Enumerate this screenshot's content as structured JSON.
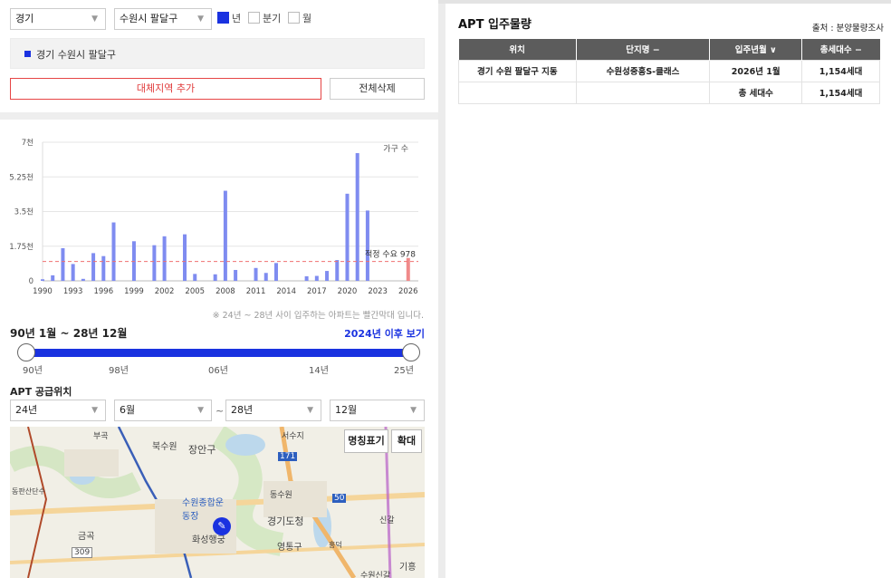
{
  "filters": {
    "province": "경기",
    "city": "수원시 팔달구",
    "period_options": [
      {
        "label": "년",
        "checked": true
      },
      {
        "label": "분기",
        "checked": false
      },
      {
        "label": "월",
        "checked": false
      }
    ]
  },
  "selected_region": "경기 수원시 팔달구",
  "buttons": {
    "add_region": "대체지역 추가",
    "delete_all": "전체삭제"
  },
  "chart_data": {
    "type": "bar",
    "legend": "가구 수",
    "y_ticks": [
      "7천",
      "5.25천",
      "3.5천",
      "1.75천",
      "0"
    ],
    "ylim": [
      0,
      7000
    ],
    "xlim": [
      1990,
      2027
    ],
    "x_ticks": [
      "1990",
      "1993",
      "1996",
      "1999",
      "2002",
      "2005",
      "2008",
      "2011",
      "2014",
      "2017",
      "2020",
      "2023",
      "2026"
    ],
    "x": [
      1990,
      1991,
      1992,
      1993,
      1994,
      1995,
      1996,
      1997,
      1999,
      2001,
      2002,
      2004,
      2005,
      2007,
      2008,
      2009,
      2011,
      2012,
      2013,
      2016,
      2017,
      2018,
      2019,
      2020,
      2021,
      2022,
      2023,
      2026
    ],
    "values": [
      80,
      280,
      1650,
      850,
      100,
      1400,
      1250,
      2950,
      2000,
      1800,
      2250,
      2350,
      350,
      330,
      4550,
      550,
      650,
      400,
      900,
      230,
      250,
      500,
      1050,
      4400,
      6450,
      3550,
      0,
      1154
    ],
    "highlight_from": 2024,
    "bar_color": "#7f8cf0",
    "highlight_color": "#f08a8a",
    "reference_line": {
      "label": "적정 수요",
      "value": 978,
      "display": "978",
      "color": "#f07070"
    },
    "note": "※ 24년 ~ 28년 사이 입주하는 아파트는 빨간막대 입니다."
  },
  "range": {
    "label": "90년 1월 ~ 28년 12월",
    "after_link": "2024년 이후 보기",
    "tick_labels": [
      "90년",
      "98년",
      "06년",
      "14년",
      "25년"
    ]
  },
  "supply": {
    "title": "APT 공급위치",
    "from_year": "24년",
    "from_month": "6월",
    "to_year": "28년",
    "to_month": "12월",
    "tilde": "~"
  },
  "map": {
    "btn_names": "명칭표기",
    "btn_zoom": "확대",
    "labels": {
      "l1": "장안구",
      "l2": "북수원",
      "l3": "경기도청",
      "l4": "영통구",
      "l5": "수원종합운동장",
      "l6": "화성행궁",
      "l7": "동수원",
      "l8": "금곡",
      "l9": "기흥",
      "l10": "309",
      "l11": "50",
      "l12": "171",
      "l13": "부곡",
      "l14": "서수지",
      "l15": "동판산단수",
      "l16": "흥덕",
      "l17": "신갈",
      "l18": "수원신갈"
    }
  },
  "supply_table": {
    "title": "APT 입주물량",
    "source": "출처 : 분양물량조사",
    "columns": [
      "위치",
      "단지명 −",
      "입주년월 ∨",
      "총세대수 −"
    ],
    "rows": [
      [
        "경기 수원 팔달구 지동",
        "수원성중흥S-클래스",
        "2026년 1월",
        "1,154세대"
      ],
      [
        "",
        "",
        "총 세대수",
        "1,154세대"
      ]
    ]
  }
}
